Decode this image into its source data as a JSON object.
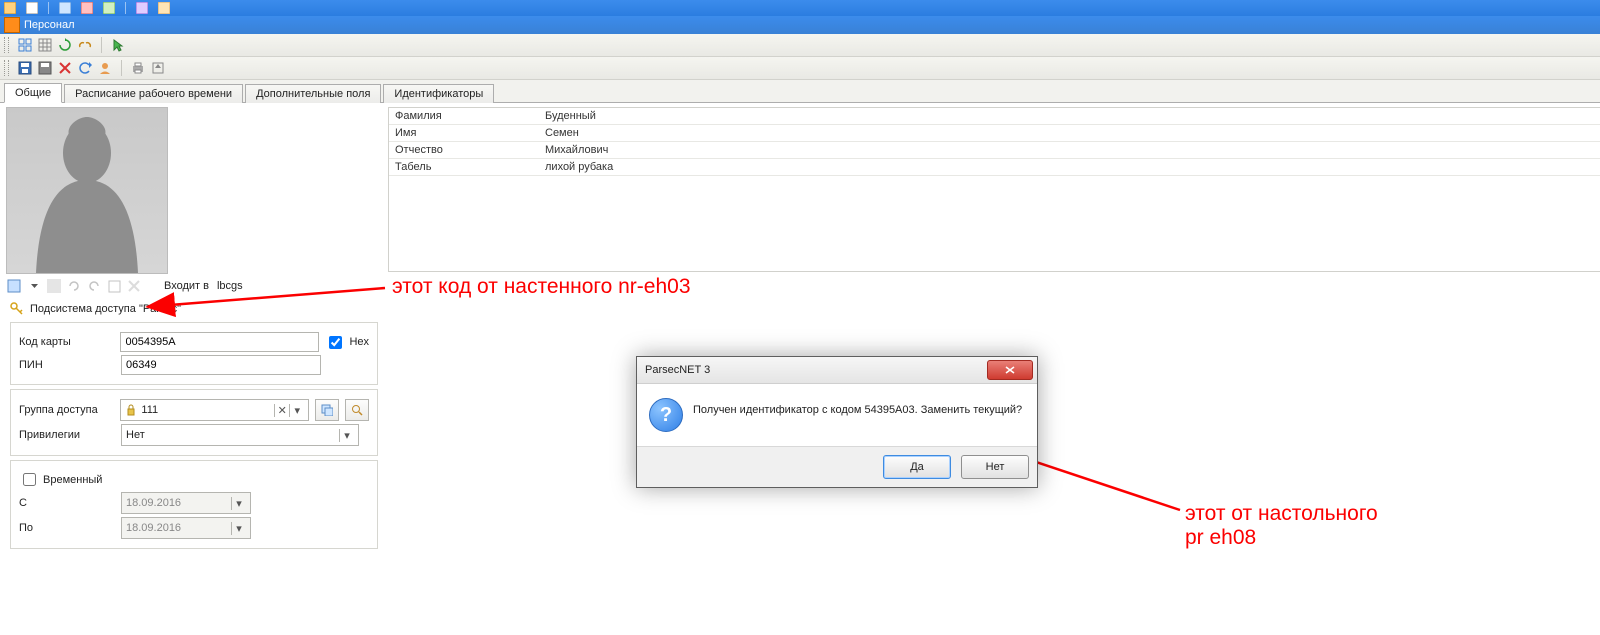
{
  "window": {
    "title": "Персонал"
  },
  "tabs": [
    {
      "label": "Общие",
      "selected": true
    },
    {
      "label": "Расписание рабочего времени",
      "selected": false
    },
    {
      "label": "Дополнительные поля",
      "selected": false
    },
    {
      "label": "Идентификаторы",
      "selected": false
    }
  ],
  "person": {
    "rows": [
      {
        "k": "Фамилия",
        "v": "Буденный"
      },
      {
        "k": "Имя",
        "v": "Семен"
      },
      {
        "k": "Отчество",
        "v": "Михайлович"
      },
      {
        "k": "Табель",
        "v": "лихой рубака"
      }
    ]
  },
  "member_of": {
    "label": "Входит в",
    "value": "lbcgs"
  },
  "subsystem_header": "Подсистема доступа \"Parsec\"",
  "card": {
    "code_label": "Код карты",
    "code_value": "0054395A",
    "hex_label": "Hex",
    "hex_checked": true,
    "pin_label": "ПИН",
    "pin_value": "06349"
  },
  "access": {
    "group_label": "Группа доступа",
    "group_value": "111",
    "priv_label": "Привилегии",
    "priv_value": "Нет"
  },
  "temp": {
    "checkbox_label": "Временный",
    "checked": false,
    "from_label": "С",
    "from_value": "18.09.2016",
    "to_label": "По",
    "to_value": "18.09.2016"
  },
  "annotations": {
    "top": "этот код от настенного nr-eh03",
    "bottom": "этот от настольного\npr eh08"
  },
  "dialog": {
    "title": "ParsecNET 3",
    "message": "Получен идентификатор с кодом 54395A03. Заменить текущий?",
    "yes": "Да",
    "no": "Нет"
  },
  "colors": {
    "annotation": "#fb0000",
    "title_grad_from": "#3c8cec",
    "title_grad_to": "#2b7de0"
  }
}
